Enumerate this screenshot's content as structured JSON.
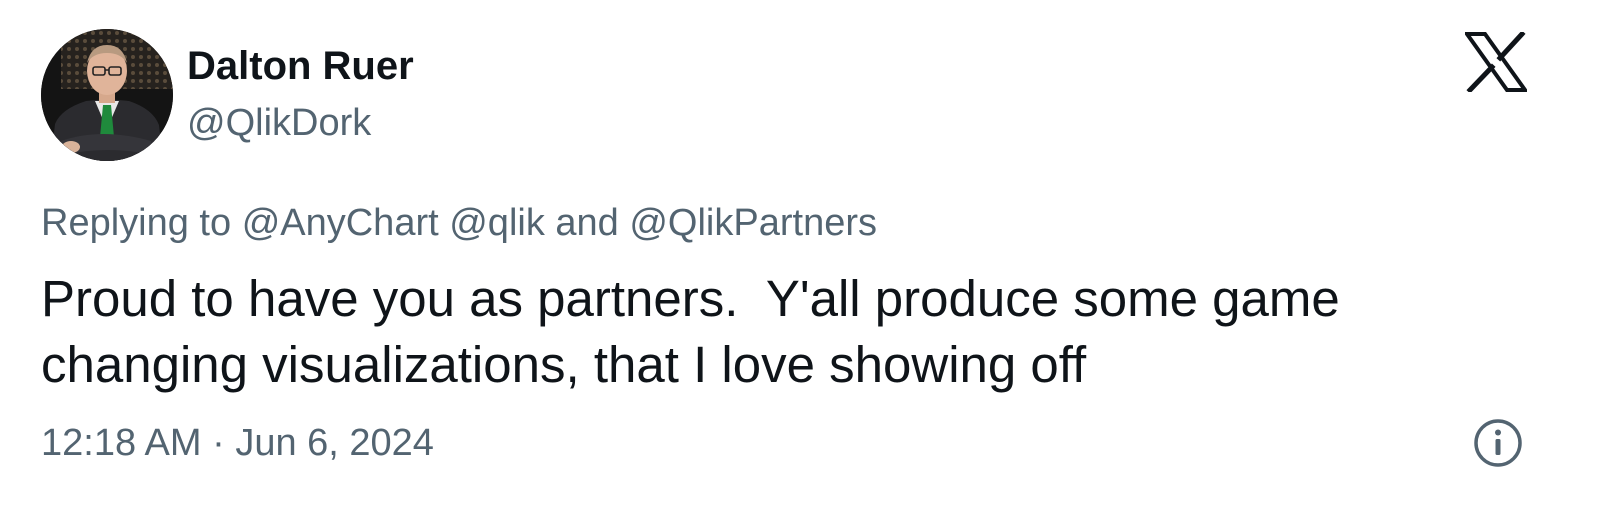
{
  "author": {
    "name": "Dalton Ruer",
    "handle": "@QlikDork"
  },
  "reply": {
    "prefix": "Replying to",
    "mention_1": "@AnyChart",
    "mention_2": "@qlik",
    "conjunction": "and",
    "mention_3": "@QlikPartners"
  },
  "tweet": {
    "text": "Proud to have you as partners.  Y'all produce some game changing visualizations, that I love showing off"
  },
  "meta": {
    "timestamp": "12:18 AM · Jun 6, 2024"
  },
  "icons": {
    "logo": "x-logo-icon",
    "info": "info-icon"
  },
  "colors": {
    "text_primary": "#0f1419",
    "text_secondary": "#536471"
  }
}
